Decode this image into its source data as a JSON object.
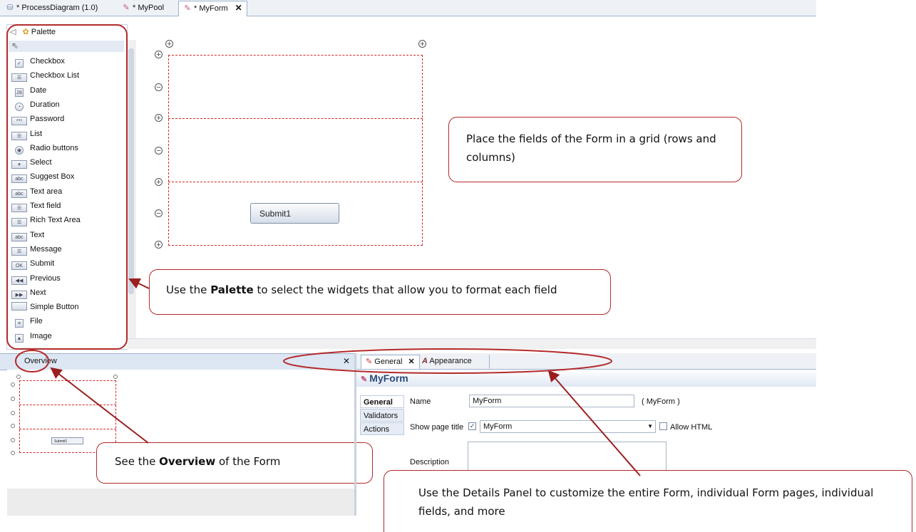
{
  "editor_tabs": [
    {
      "label": "* ProcessDiagram (1.0)"
    },
    {
      "label": "* MyPool"
    },
    {
      "label": "* MyForm"
    }
  ],
  "palette": {
    "title": "Palette",
    "items": [
      {
        "label": "Checkbox",
        "icon": "checkbox-icon"
      },
      {
        "label": "Checkbox List",
        "icon": "checkbox-list-icon"
      },
      {
        "label": "Date",
        "icon": "date-icon"
      },
      {
        "label": "Duration",
        "icon": "duration-icon"
      },
      {
        "label": "Password",
        "icon": "password-icon"
      },
      {
        "label": "List",
        "icon": "list-icon"
      },
      {
        "label": "Radio buttons",
        "icon": "radio-icon"
      },
      {
        "label": "Select",
        "icon": "select-icon"
      },
      {
        "label": "Suggest Box",
        "icon": "suggest-box-icon"
      },
      {
        "label": "Text area",
        "icon": "text-area-icon"
      },
      {
        "label": "Text field",
        "icon": "text-field-icon"
      },
      {
        "label": "Rich Text Area",
        "icon": "rich-text-icon"
      },
      {
        "label": "Text",
        "icon": "text-icon"
      },
      {
        "label": "Message",
        "icon": "message-icon"
      },
      {
        "label": "Submit",
        "icon": "submit-icon"
      },
      {
        "label": "Previous",
        "icon": "previous-icon"
      },
      {
        "label": "Next",
        "icon": "next-icon"
      },
      {
        "label": "Simple Button",
        "icon": "simple-button-icon"
      },
      {
        "label": "File",
        "icon": "file-icon"
      },
      {
        "label": "Image",
        "icon": "image-icon"
      }
    ]
  },
  "canvas": {
    "submit_label": "Submit1"
  },
  "callouts": {
    "grid": "Place the fields of the Form in a grid (rows and columns)",
    "palette_prefix": "Use the ",
    "palette_bold": "Palette",
    "palette_suffix": " to select the widgets that allow you to format each field",
    "overview_prefix": "See the ",
    "overview_bold": "Overview",
    "overview_suffix": " of the Form",
    "details": "Use the Details Panel to customize the entire Form, individual Form pages, individual fields, and more"
  },
  "overview": {
    "tab_label": "Overview",
    "mini_submit": "Submit1"
  },
  "details": {
    "tabs": [
      {
        "label": "General"
      },
      {
        "label": "Appearance"
      }
    ],
    "title": "MyForm",
    "side_tabs": [
      "General",
      "Validators",
      "Actions"
    ],
    "name_label": "Name",
    "name_value": "MyForm",
    "name_hint": "( MyForm )",
    "show_title_label": "Show page title",
    "show_title_value": "MyForm",
    "allow_html_label": "Allow HTML",
    "description_label": "Description"
  },
  "colors": {
    "callout_border": "#b32a2a",
    "grid_dash": "#d62828",
    "accent": "#2a4a7a"
  }
}
